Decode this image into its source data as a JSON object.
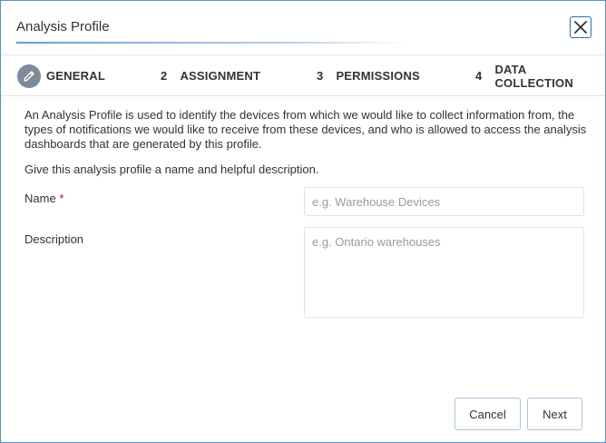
{
  "dialog": {
    "title": "Analysis Profile"
  },
  "steps": [
    {
      "number": "",
      "label": "GENERAL",
      "icon": "pencil-icon",
      "active": true
    },
    {
      "number": "2",
      "label": "ASSIGNMENT"
    },
    {
      "number": "3",
      "label": "PERMISSIONS"
    },
    {
      "number": "4",
      "label": "DATA COLLECTION"
    }
  ],
  "content": {
    "intro": "An Analysis Profile is used to identify the devices from which we would like to collect information from, the types of notifications we would like to receive from these devices, and who is allowed to access the analysis dashboards that are generated by this profile.",
    "subintro": "Give this analysis profile a name and helpful description."
  },
  "form": {
    "name_label": "Name",
    "required_marker": "*",
    "name_placeholder": "e.g. Warehouse Devices",
    "name_value": "",
    "description_label": "Description",
    "description_placeholder": "e.g. Ontario warehouses",
    "description_value": ""
  },
  "footer": {
    "cancel_label": "Cancel",
    "next_label": "Next"
  },
  "colors": {
    "accent": "#2c6fb1",
    "border": "#5b95c7",
    "required": "#d0021b",
    "step_icon_bg": "#7b8b9a"
  }
}
